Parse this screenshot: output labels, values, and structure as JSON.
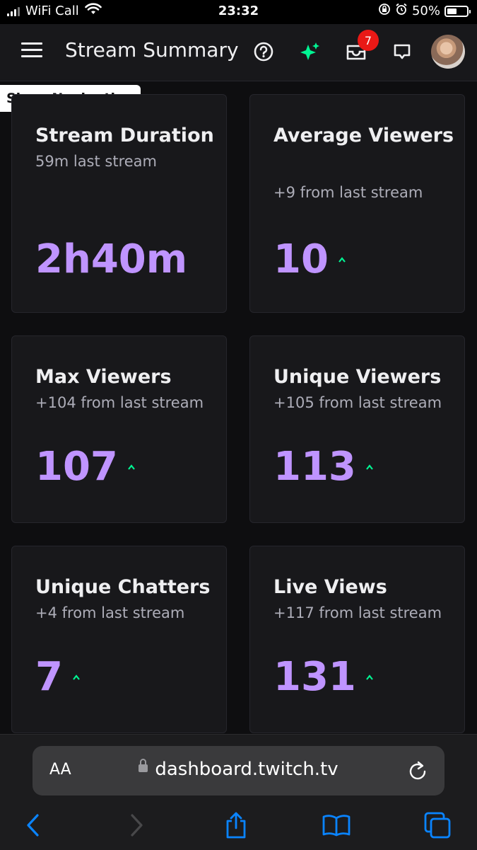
{
  "status_bar": {
    "carrier": "WiFi Call",
    "time": "23:32",
    "battery_percent": "50%",
    "battery_level": 0.5,
    "icons": [
      "signal-icon",
      "wifi-icon",
      "orientation-lock-icon",
      "alarm-icon",
      "battery-icon"
    ]
  },
  "header": {
    "title": "Stream Summary",
    "notification_count": "7",
    "icons": [
      "menu-icon",
      "help-icon",
      "sparkle-icon",
      "inbox-icon",
      "whisper-icon",
      "avatar"
    ]
  },
  "tooltip": {
    "text": "Show Navigation"
  },
  "cards": [
    {
      "title": "Stream Duration",
      "subtitle": "59m last stream",
      "value": "2h40m",
      "trend": "none"
    },
    {
      "title": "Average Viewers",
      "subtitle": "+9 from last stream",
      "value": "10",
      "trend": "up"
    },
    {
      "title": "Max Viewers",
      "subtitle": "+104 from last stream",
      "value": "107",
      "trend": "up"
    },
    {
      "title": "Unique Viewers",
      "subtitle": "+105 from last stream",
      "value": "113",
      "trend": "up"
    },
    {
      "title": "Unique Chatters",
      "subtitle": "+4 from last stream",
      "value": "7",
      "trend": "up"
    },
    {
      "title": "Live Views",
      "subtitle": "+117 from last stream",
      "value": "131",
      "trend": "up"
    }
  ],
  "browser": {
    "text_size_label": "AA",
    "url": "dashboard.twitch.tv",
    "icons": [
      "lock-icon",
      "reload-icon",
      "back-icon",
      "forward-icon",
      "share-icon",
      "bookmarks-icon",
      "tabs-icon"
    ]
  },
  "colors": {
    "background": "#0e0e10",
    "card": "#18181b",
    "accent_purple": "#bf94ff",
    "trend_green": "#00f593",
    "badge_red": "#e91916",
    "safari_blue": "#0a84ff"
  }
}
